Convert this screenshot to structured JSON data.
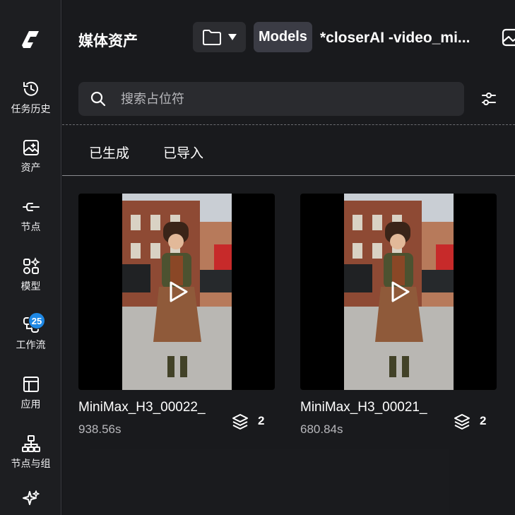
{
  "sidebar": {
    "logo": "comfy-logo",
    "items": [
      {
        "label": "任务历史",
        "icon": "history-icon"
      },
      {
        "label": "资产",
        "icon": "image-sparkle-icon"
      },
      {
        "label": "节点",
        "icon": "node-plug-icon"
      },
      {
        "label": "模型",
        "icon": "model-grid-icon"
      },
      {
        "label": "工作流",
        "icon": "workflow-icon",
        "badge": "25"
      },
      {
        "label": "应用",
        "icon": "layout-icon"
      },
      {
        "label": "节点与组",
        "icon": "hierarchy-icon"
      },
      {
        "label": "",
        "icon": "sparkle-icon"
      }
    ]
  },
  "header": {
    "title": "媒体资产",
    "models_label": "Models",
    "workflow_name": "*closerAI -video_mi..."
  },
  "search": {
    "placeholder": "搜索占位符"
  },
  "tabs": [
    {
      "label": "已生成"
    },
    {
      "label": "已导入"
    }
  ],
  "assets": [
    {
      "name": "MiniMax_H3_00022_",
      "duration": "938.56s",
      "layers": "2"
    },
    {
      "name": "MiniMax_H3_00021_",
      "duration": "680.84s",
      "layers": "2"
    }
  ],
  "colors": {
    "accent_badge": "#1e88e5",
    "panel_bg": "#1a1b1e",
    "sidebar_bg": "#1d1e21"
  }
}
